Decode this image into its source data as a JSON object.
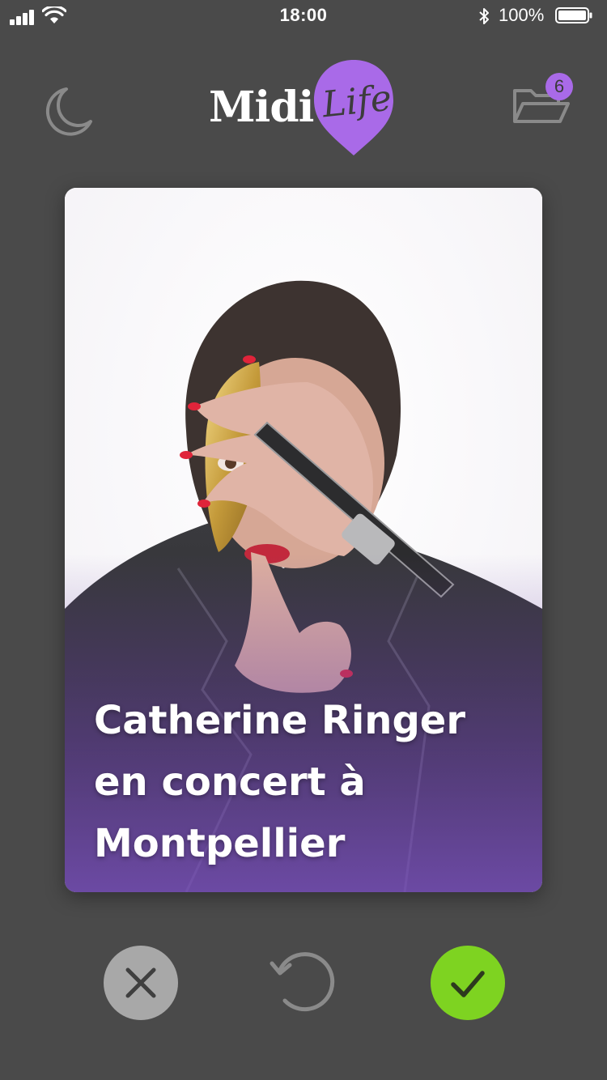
{
  "status_bar": {
    "time": "18:00",
    "battery_percent": "100%",
    "icons": [
      "signal-icon",
      "wifi-icon",
      "bluetooth-icon",
      "battery-icon"
    ]
  },
  "header": {
    "logo_text_primary": "Midi",
    "logo_text_secondary": "Life",
    "folder_badge_count": "6",
    "icons": [
      "moon-icon",
      "folder-icon"
    ],
    "colors": {
      "accent": "#a96ae8"
    }
  },
  "card": {
    "title_lines": [
      "Catherine Ringer",
      "en concert à",
      "Montpellier"
    ]
  },
  "actions": {
    "reject_icon": "close-icon",
    "undo_icon": "undo-icon",
    "accept_icon": "check-icon",
    "colors": {
      "reject": "#a8a8a8",
      "accept": "#7ed321"
    }
  }
}
